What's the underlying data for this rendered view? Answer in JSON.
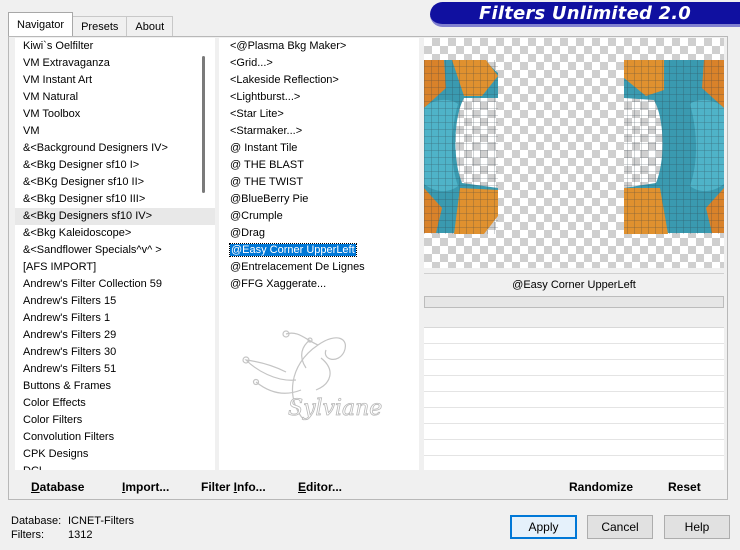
{
  "app_title": "Filters Unlimited 2.0",
  "tabs": [
    {
      "label": "Navigator",
      "active": true
    },
    {
      "label": "Presets",
      "active": false
    },
    {
      "label": "About",
      "active": false
    }
  ],
  "categories": [
    "Kiwi`s Oelfilter",
    "VM Extravaganza",
    "VM Instant Art",
    "VM Natural",
    "VM Toolbox",
    "VM",
    "&<Background Designers IV>",
    "&<Bkg Designer sf10 I>",
    "&<BKg Designer sf10 II>",
    "&<Bkg Designer sf10 III>",
    "&<Bkg Designers sf10 IV>",
    "&<Bkg Kaleidoscope>",
    "&<Sandflower Specials^v^ >",
    "[AFS IMPORT]",
    "Andrew's Filter Collection 59",
    "Andrew's Filters 15",
    "Andrew's Filters 1",
    "Andrew's Filters 29",
    "Andrew's Filters 30",
    "Andrew's Filters 51",
    "Buttons & Frames",
    "Color Effects",
    "Color Filters",
    "Convolution Filters",
    "CPK Designs",
    "DCL..."
  ],
  "current_category_index": 10,
  "filters": [
    "<@Plasma Bkg Maker>",
    "<Grid...>",
    "<Lakeside Reflection>",
    "<Lightburst...>",
    "<Star Lite>",
    "<Starmaker...>",
    "@ Instant Tile",
    "@ THE BLAST",
    "@ THE TWIST",
    "@BlueBerry Pie",
    "@Crumple",
    "@Drag",
    "@Easy Corner UpperLeft",
    "@Entrelacement De Lignes",
    "@FFG Xaggerate..."
  ],
  "selected_filter_index": 12,
  "selected_filter_name": "@Easy Corner UpperLeft",
  "watermark_text": "Sylviane",
  "left_buttons": [
    {
      "label": "Database",
      "accel": "D"
    },
    {
      "label": "Import...",
      "accel": "I"
    },
    {
      "label": "Filter Info...",
      "accel": "I"
    },
    {
      "label": "Editor...",
      "accel": "E"
    }
  ],
  "right_buttons": [
    {
      "label": "Randomize"
    },
    {
      "label": "Reset"
    }
  ],
  "status": {
    "database_label": "Database:",
    "database_value": "ICNET-Filters",
    "filters_label": "Filters:",
    "filters_value": "1312"
  },
  "dialog_buttons": {
    "apply": "Apply",
    "cancel": "Cancel",
    "help": "Help"
  },
  "colors": {
    "banner": "#1010a0",
    "selection": "#0078d7",
    "preview_teal": "#3fa3b8",
    "preview_orange": "#e08a2a"
  }
}
